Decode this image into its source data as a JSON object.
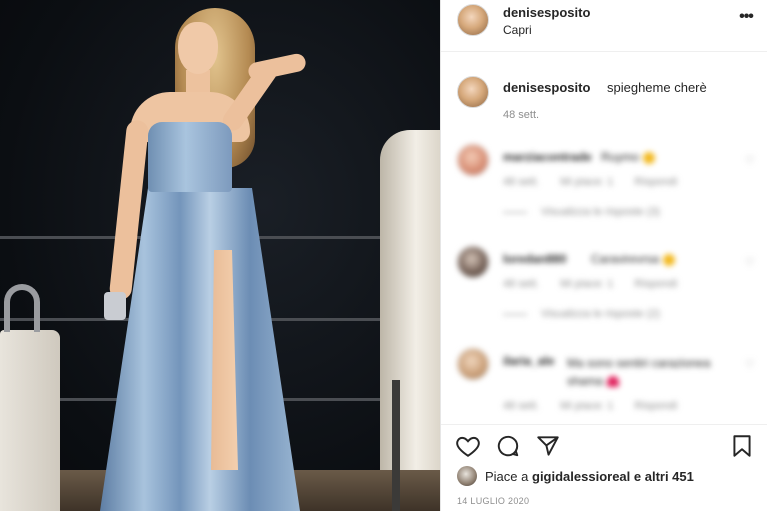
{
  "header": {
    "username": "denisesposito",
    "location": "Capri",
    "more_icon": "more-options-icon"
  },
  "caption": {
    "username": "denisesposito",
    "text": "spieghеme cherè",
    "time": "48 sett."
  },
  "comments": [
    {
      "user": "marziacontrade",
      "text": "Ruymo",
      "time": "48 sett.",
      "likes": "Mi piace: 1",
      "reply": "Rispondi",
      "view_replies": "Visualizza le risposte (3)"
    },
    {
      "user": "loredan880",
      "text": "Caravirevrsa",
      "time": "48 sett.",
      "likes": "Mi piace: 1",
      "reply": "Rispondi",
      "view_replies": "Visualizza le risposte (2)"
    },
    {
      "user": "ilaria_ale",
      "text": "Ma sono sentiri carazionea shama",
      "time": "48 sett.",
      "likes": "Mi piace: 1",
      "reply": "Rispondi"
    }
  ],
  "actions": {
    "like_icon": "heart-icon",
    "comment_icon": "comment-icon",
    "share_icon": "send-icon",
    "save_icon": "bookmark-icon"
  },
  "likes": {
    "prefix": "Piace a",
    "user": "gigidalessioreal",
    "suffix": "e altri 451"
  },
  "date": "14 LUGLIO 2020",
  "colors": {
    "text": "#262626",
    "muted": "#8e8e8e",
    "dress": "#8fafd1"
  }
}
